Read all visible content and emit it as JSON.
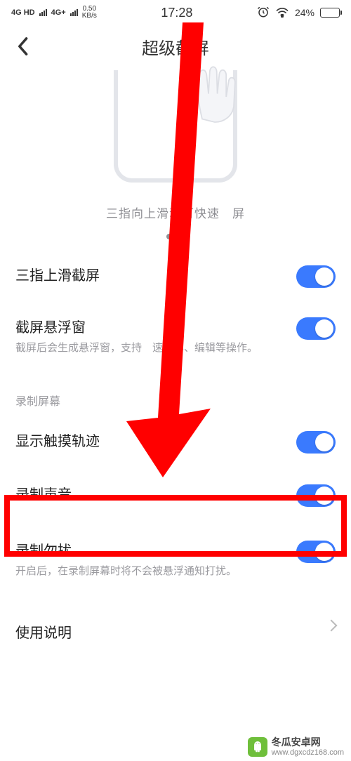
{
  "status": {
    "sig1": "4G HD",
    "sig2": "4G+",
    "speed_top": "0.50",
    "speed_bottom": "KB/s",
    "time": "17:28",
    "battery_pct": "24%"
  },
  "header": {
    "title": "超级截屏"
  },
  "illustration": {
    "caption_prefix": "三指向上滑动可快速",
    "caption_suffix": "屏"
  },
  "settings": {
    "row1": {
      "title": "三指上滑截屏"
    },
    "row2": {
      "title": "截屏悬浮窗",
      "desc_prefix": "截屏后会生成悬浮窗，支持",
      "desc_suffix": "速分享、编辑等操作。"
    },
    "section2_label": "录制屏幕",
    "row3": {
      "title": "显示触摸轨迹"
    },
    "row4": {
      "title": "录制声音"
    },
    "row5": {
      "title": "录制勿扰",
      "desc": "开启后，在录制屏幕时将不会被悬浮通知打扰。"
    },
    "row6": {
      "title": "使用说明"
    }
  },
  "watermark": {
    "line1": "冬瓜安卓网",
    "line2": "www.dgxcdz168.com"
  },
  "colors": {
    "accent": "#3a7afe",
    "annotation": "#ff0000"
  }
}
